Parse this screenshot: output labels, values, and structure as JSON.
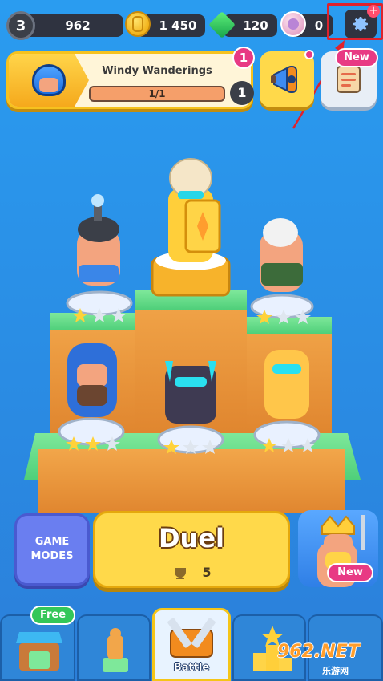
{
  "top_bar": {
    "level": "3",
    "xp": "962",
    "gold": "1 450",
    "gems": "120",
    "tokens": "0",
    "settings_notif": "+",
    "icons": [
      "coin-icon",
      "gem-icon",
      "token-icon",
      "gear-icon"
    ]
  },
  "event": {
    "title": "Windy Wanderings",
    "progress": "1/1",
    "count": "1",
    "notification": "1"
  },
  "news": {
    "badge": "New"
  },
  "stage": {
    "units": [
      {
        "name": "bomber",
        "stars": 1
      },
      {
        "name": "knight-top",
        "stars": 0
      },
      {
        "name": "barbarian-green",
        "stars": 1
      },
      {
        "name": "wizard-blue",
        "stars": 2
      },
      {
        "name": "mini-pekka",
        "stars": 1
      },
      {
        "name": "archer-queen",
        "stars": 1
      }
    ]
  },
  "actions": {
    "game_modes": "GAME MODES",
    "duel": "Duel",
    "duel_trophies": "5",
    "hero_badge": "New"
  },
  "tabs": [
    {
      "id": "shop",
      "label": "",
      "badge": "Free"
    },
    {
      "id": "collection",
      "label": ""
    },
    {
      "id": "battle",
      "label": "Battle",
      "active": true
    },
    {
      "id": "progress",
      "label": ""
    },
    {
      "id": "events",
      "label": ""
    }
  ],
  "watermark": {
    "main": "962.NET",
    "sub": "乐游网"
  },
  "colors": {
    "background": "#2a8fe6",
    "accent_yellow": "#ffd94a",
    "badge_pink": "#e83a84",
    "highlight_red": "#e0222c"
  }
}
